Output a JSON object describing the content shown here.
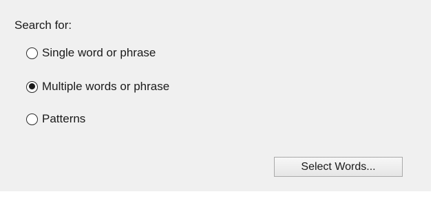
{
  "search": {
    "label": "Search for:",
    "options": [
      {
        "label": "Single word or phrase",
        "selected": false
      },
      {
        "label": "Multiple words or phrase",
        "selected": true
      },
      {
        "label": "Patterns",
        "selected": false
      }
    ],
    "select_words_button": "Select Words..."
  }
}
